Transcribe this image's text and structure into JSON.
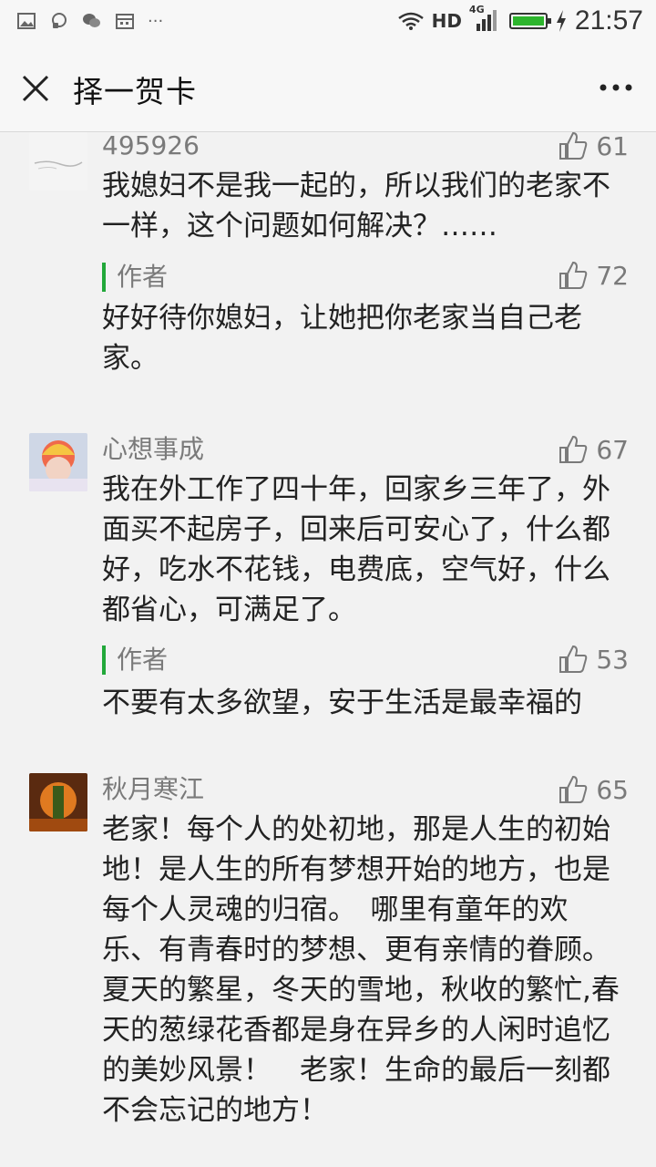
{
  "status_bar": {
    "network": "HD",
    "signal_label": "4G",
    "time": "21:57"
  },
  "header": {
    "title": "择一贺卡"
  },
  "comments": [
    {
      "user": "495926",
      "likes": "61",
      "text": "我媳妇不是我一起的，所以我们的老家不一样，这个问题如何解决？……",
      "reply": {
        "author": "作者",
        "likes": "72",
        "text": "好好待你媳妇，让她把你老家当自己老家。"
      }
    },
    {
      "user": "心想事成",
      "likes": "67",
      "text": "我在外工作了四十年，回家乡三年了，外面买不起房子，回来后可安心了，什么都好，吃水不花钱，电费底，空气好，什么都省心，可满足了。",
      "reply": {
        "author": "作者",
        "likes": "53",
        "text": "不要有太多欲望，安于生活是最幸福的"
      }
    },
    {
      "user": "秋月寒江",
      "likes": "65",
      "text": "老家！每个人的处初地，那是人生的初始地！是人生的所有梦想开始的地方，也是每个人灵魂的归宿。　哪里有童年的欢乐、有青春时的梦想、更有亲情的眷顾。　　夏天的繁星，冬天的雪地，秋收的繁忙,春天的葱绿花香都是身在异乡的人闲时追忆的美妙风景！　老家！生命的最后一刻都不会忘记的地方！"
    }
  ]
}
